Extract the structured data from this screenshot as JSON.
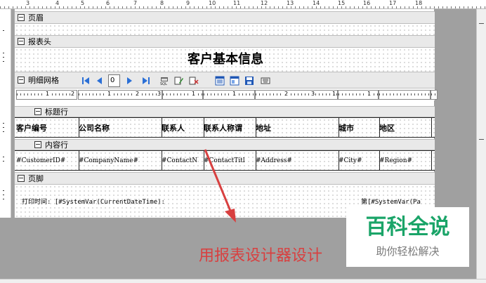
{
  "ruler": {
    "numbers": [
      "3",
      "4",
      "5",
      "6",
      "7",
      "8",
      "9",
      "10",
      "11",
      "12",
      "13",
      "14",
      "15",
      "16",
      "17",
      "18"
    ]
  },
  "bands": {
    "page_header": "页眉",
    "report_header": "报表头",
    "detail_grid": "明细网格",
    "title_row": "标题行",
    "content_row": "内容行",
    "page_footer": "页脚"
  },
  "report_title": "客户基本信息",
  "toolbar": {
    "icons": [
      "first-icon",
      "prev-icon",
      "next-icon",
      "last-icon",
      "print-sql-icon",
      "edit-icon",
      "delete-icon",
      "grid-icon",
      "layout-icon",
      "save-icon",
      "keyboard-icon"
    ],
    "page_value": "0"
  },
  "subruler": {
    "numbers": [
      "1",
      "2",
      "1",
      "2",
      "3",
      "1",
      "1",
      "2",
      "3",
      "1",
      "1"
    ]
  },
  "columns": {
    "headers": [
      "客户编号",
      "公司名称",
      "联系人",
      "联系人称谓",
      "地址",
      "城市",
      "地区"
    ],
    "fields": [
      "#CustomerID#",
      "#CompanyName#",
      "#ContactN",
      "#ContactTitl",
      "#Address#",
      "#City#",
      "#Region#"
    ]
  },
  "footer": {
    "print_time": "打印时间: [#SystemVar(CurrentDateTime):",
    "page_label": "第[#SystemVar(Pa"
  },
  "annotation": "用报表设计器设计",
  "watermark": {
    "title": "百科全说",
    "subtitle": "助你轻松解决"
  },
  "colors": {
    "annotation": "#d84040",
    "watermark_title": "#1aa468",
    "band_bg": "#e9e9e9",
    "canvas_bg": "#a0a0a0"
  }
}
